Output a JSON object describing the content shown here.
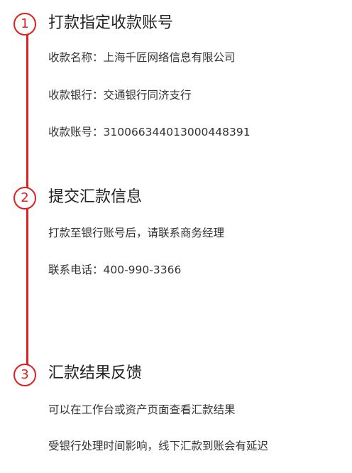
{
  "colors": {
    "accent": "#e02020",
    "title_text": "#222222",
    "body_text": "#333333"
  },
  "steps": [
    {
      "number": "1",
      "title": "打款指定收款账号",
      "lines": [
        "收款名称：上海千匠网络信息有限公司",
        "收款银行：交通银行同济支行",
        "收款账号：310066344013000448391"
      ]
    },
    {
      "number": "2",
      "title": "提交汇款信息",
      "lines": [
        "打款至银行账号后，请联系商务经理",
        "联系电话：400-990-3366"
      ]
    },
    {
      "number": "3",
      "title": "汇款结果反馈",
      "lines": [
        "可以在工作台或资产页面查看汇款结果",
        "受银行处理时间影响，线下汇款到账会有延迟"
      ]
    }
  ]
}
